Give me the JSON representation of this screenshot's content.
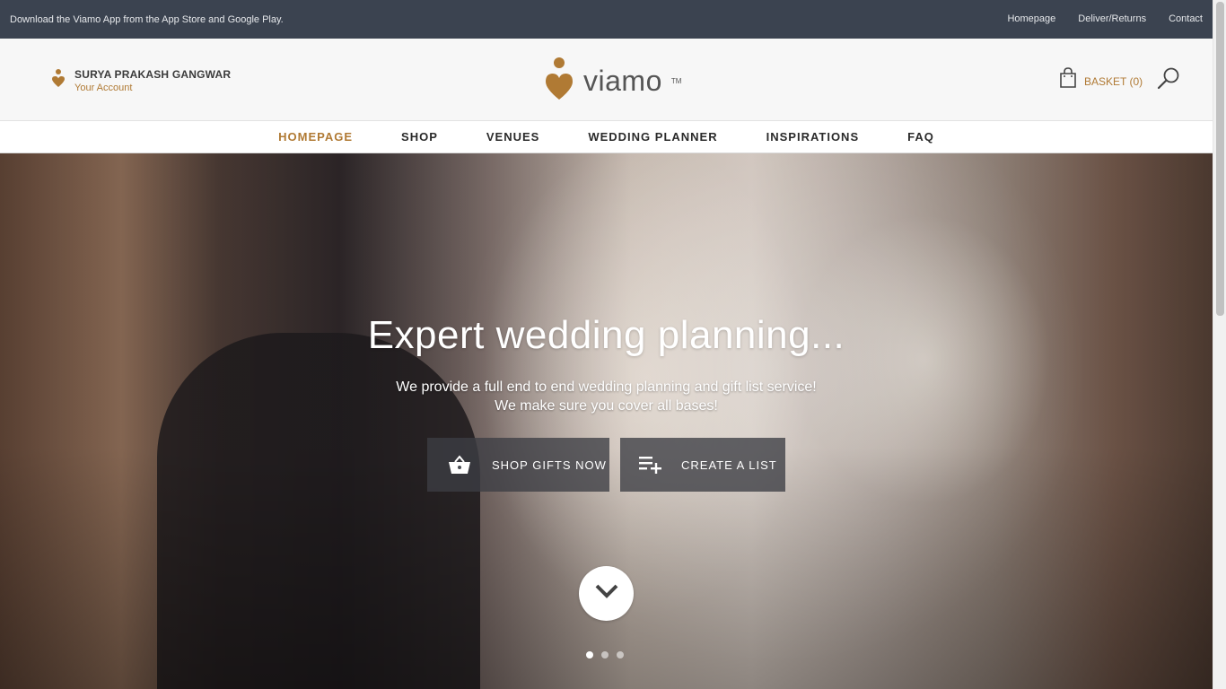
{
  "topbar": {
    "promo": "Download the Viamo App from the App Store and Google Play.",
    "links": [
      "Homepage",
      "Deliver/Returns",
      "Contact"
    ]
  },
  "header": {
    "account_name": "SURYA PRAKASH GANGWAR",
    "account_link": "Your Account",
    "logo_text": "viamo",
    "logo_tm": "TM",
    "basket_label": "BASKET (0)"
  },
  "nav": {
    "items": [
      "HOMEPAGE",
      "SHOP",
      "VENUES",
      "WEDDING PLANNER",
      "INSPIRATIONS",
      "FAQ"
    ],
    "active": "HOMEPAGE"
  },
  "hero": {
    "title": "Expert wedding planning...",
    "subtitle_line1": "We provide a full end to end wedding planning and gift list service!",
    "subtitle_line2": "We make sure you cover all bases!",
    "shop_button": "SHOP GIFTS NOW",
    "list_button": "CREATE A LIST",
    "slide_count": 3,
    "active_slide": 1
  },
  "colors": {
    "brand": "#b07a34",
    "topbar": "#3b4350"
  }
}
